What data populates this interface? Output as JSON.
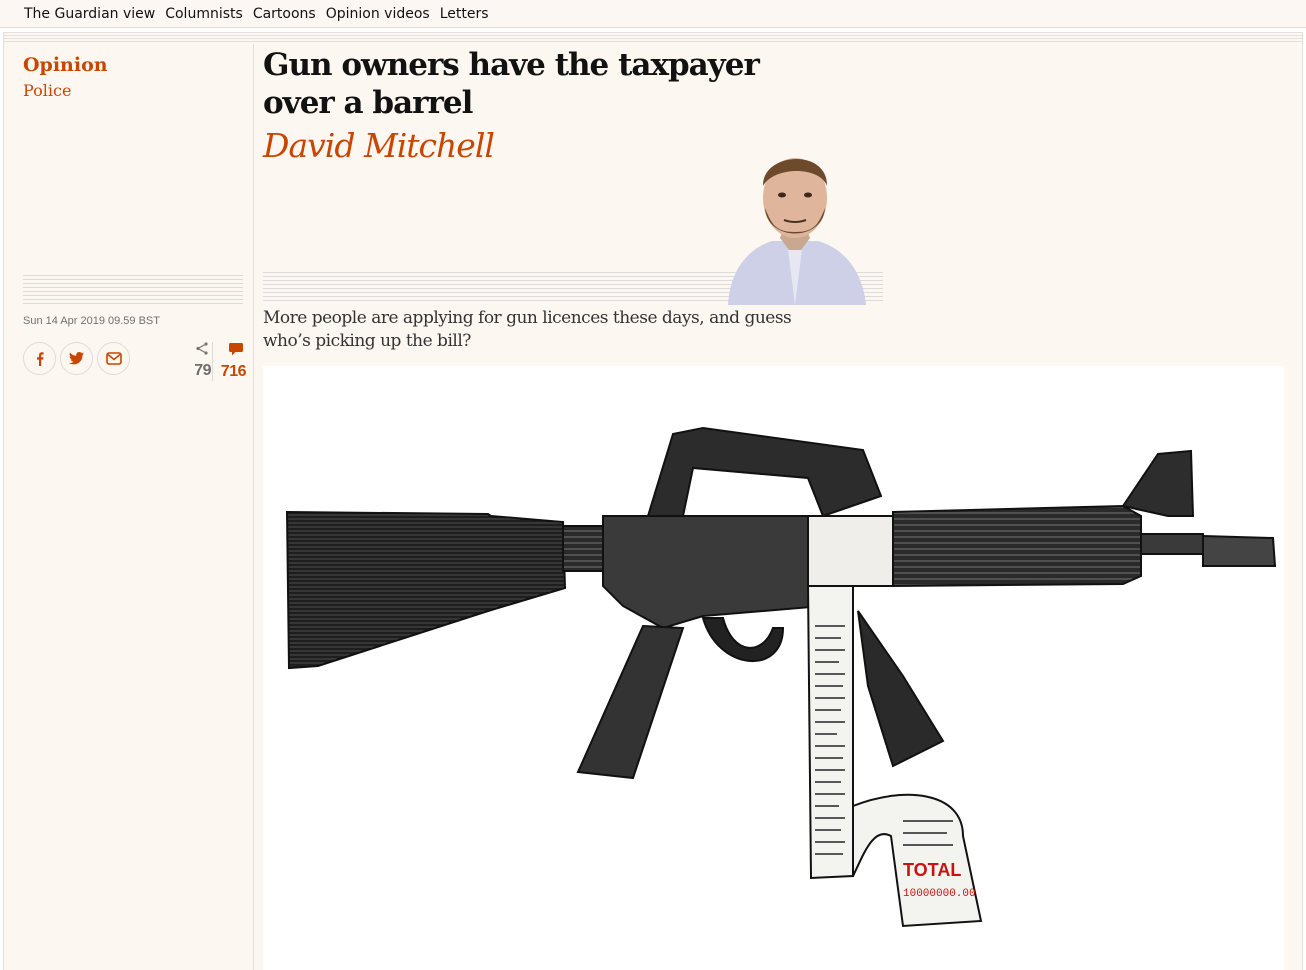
{
  "subnav": [
    "The Guardian view",
    "Columnists",
    "Cartoons",
    "Opinion videos",
    "Letters"
  ],
  "section": "Opinion",
  "series": "Police",
  "headline": "Gun owners have the taxpayer over a barrel",
  "byline": "David Mitchell",
  "standfirst": "More people are applying for gun licences these days, and guess who’s picking up the bill?",
  "date": "Sun 14 Apr 2019 09.59 BST",
  "share_count": "79",
  "comment_count": "716",
  "receipt": {
    "total_label": "TOTAL",
    "total_value": "10000000.00"
  },
  "colors": {
    "accent": "#c74600",
    "background": "#fdf7f1",
    "text": "#121212"
  }
}
